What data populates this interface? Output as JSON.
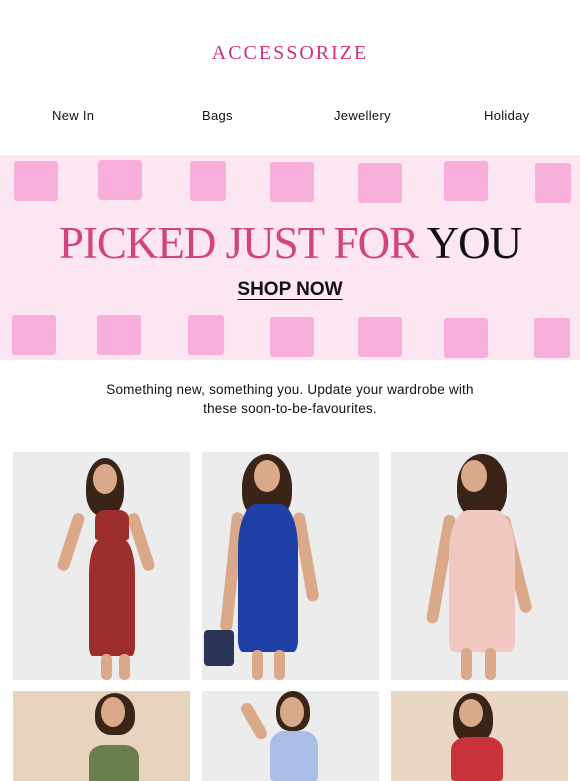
{
  "brand": {
    "logo_text": "ACCESSORIZE",
    "accent_color": "#d12f7d"
  },
  "nav": {
    "items": [
      "New In",
      "Bags",
      "Jewellery",
      "Holiday"
    ]
  },
  "banner": {
    "title_pink": "PICKED JUST FOR ",
    "title_dark": "YOU",
    "cta": "SHOP NOW",
    "background_color": "#fce6f1",
    "title_color": "#d2447f"
  },
  "intro": {
    "line1": "Something new, something you. Update your wardrobe with",
    "line2": "these soon-to-be-favourites."
  },
  "products": [
    {
      "name": "red-print-dress-product",
      "dress_color": "#9b2d2d"
    },
    {
      "name": "blue-dress-product",
      "dress_color": "#1f3fa6"
    },
    {
      "name": "floral-dress-product",
      "dress_color": "#f0c8c0"
    },
    {
      "name": "green-top-product",
      "dress_color": "#6b7f4e"
    },
    {
      "name": "blue-smocked-dress-product",
      "dress_color": "#a9bde6"
    },
    {
      "name": "red-floral-dress-product",
      "dress_color": "#c8323a"
    }
  ]
}
